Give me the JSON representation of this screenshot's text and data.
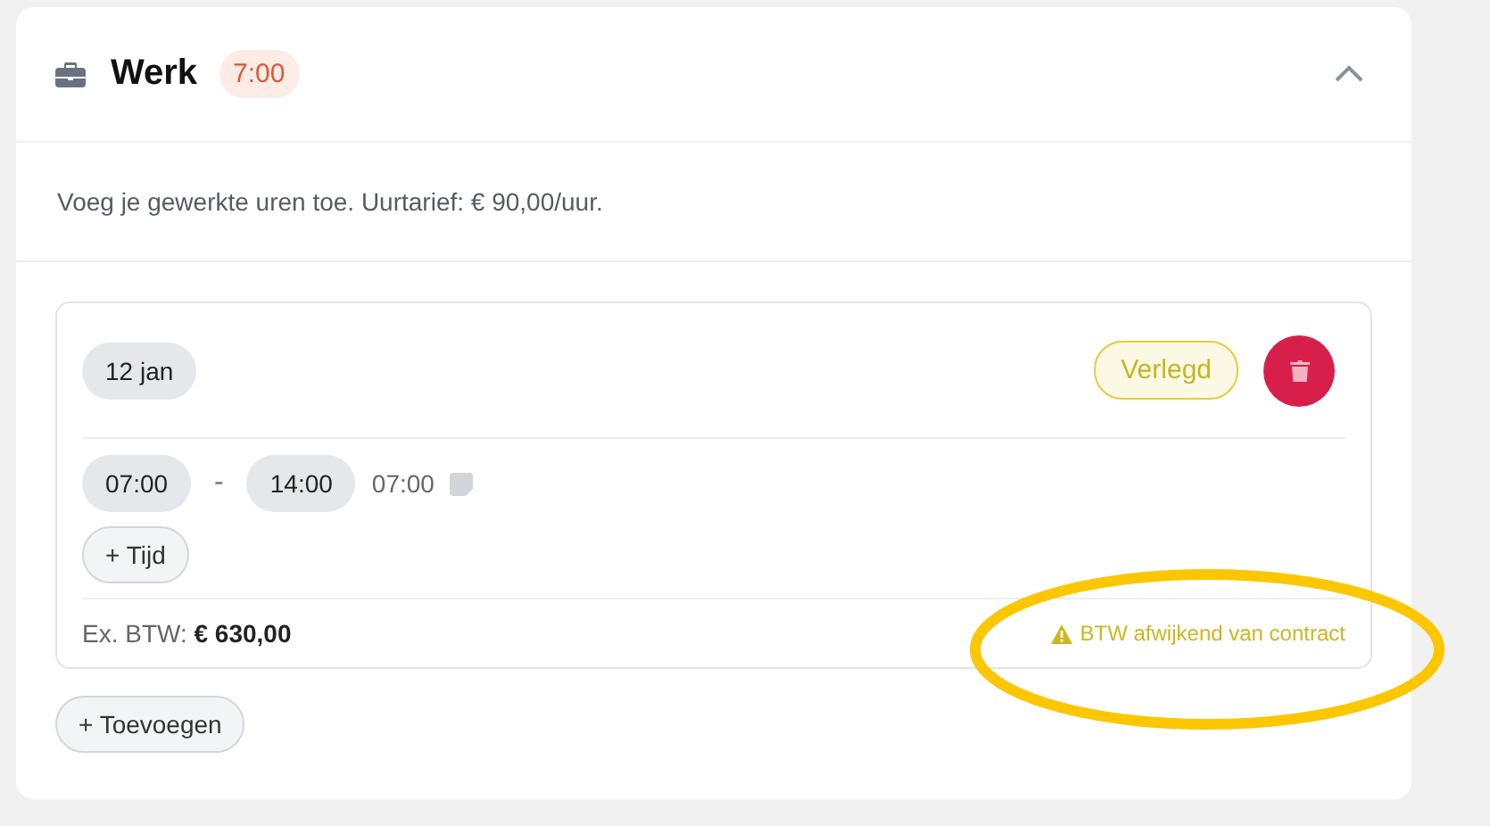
{
  "section": {
    "title": "Werk",
    "hours_badge": "7:00",
    "expanded": true,
    "description": "Voeg je gewerkte uren toe. Uurtarief: € 90,00/uur."
  },
  "entries": [
    {
      "date": "12 jan",
      "tag": "Verlegd",
      "times": [
        {
          "start": "07:00",
          "separator": "-",
          "end": "14:00",
          "duration": "07:00"
        }
      ],
      "add_time": "+ Tijd",
      "total": "Ex. BTW: **€ 630,00**",
      "warning": "BTW afwijkend van contract"
    }
  ],
  "add_button": "+ Toevoegen",
  "annotation": {
    "kind": "ellipse"
  }
}
